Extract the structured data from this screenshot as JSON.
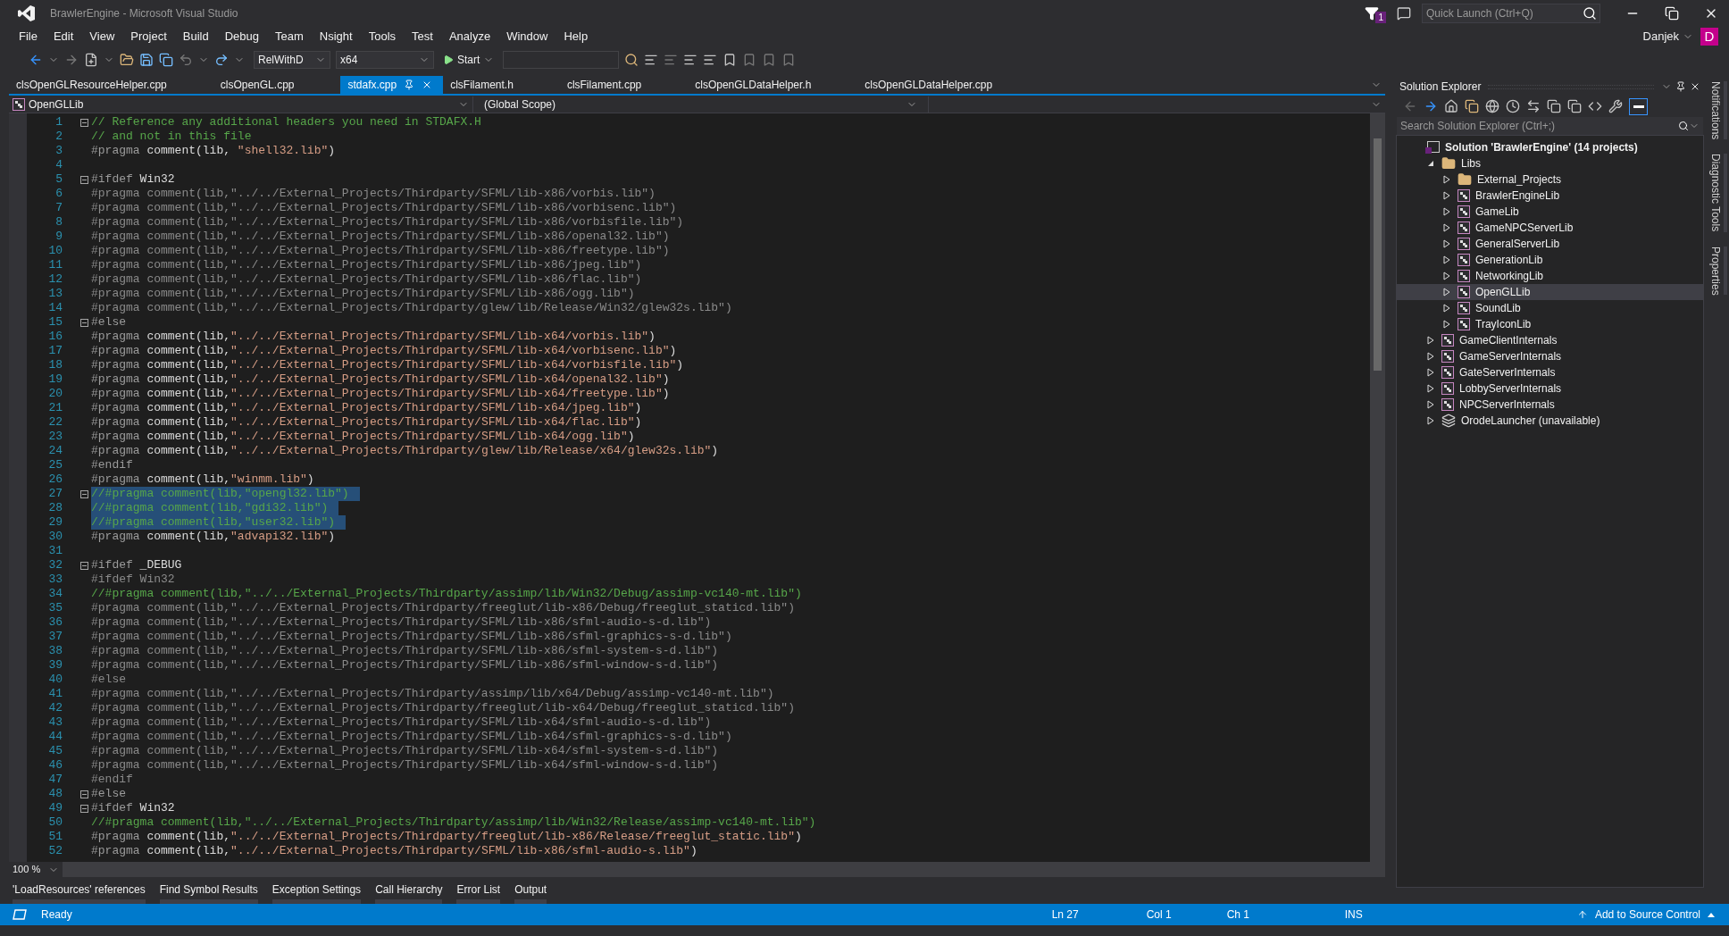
{
  "window": {
    "title": "BrawlerEngine - Microsoft Visual Studio",
    "notification_count": "1",
    "quick_launch": {
      "placeholder": "Quick Launch (Ctrl+Q)"
    },
    "user": "Danjek",
    "avatar_letter": "D"
  },
  "menu": [
    "File",
    "Edit",
    "View",
    "Project",
    "Build",
    "Debug",
    "Team",
    "Nsight",
    "Tools",
    "Test",
    "Analyze",
    "Window",
    "Help"
  ],
  "toolbar": {
    "configuration": "RelWithD",
    "platform": "x64",
    "start": "Start"
  },
  "tabs": [
    {
      "label": "clsOpenGLResourceHelper.cpp",
      "selected": false
    },
    {
      "label": "clsOpenGL.cpp",
      "selected": false
    },
    {
      "label": "stdafx.cpp",
      "selected": true
    },
    {
      "label": "clsFilament.h",
      "selected": false
    },
    {
      "label": "clsFilament.cpp",
      "selected": false
    },
    {
      "label": "clsOpenGLDataHelper.h",
      "selected": false
    },
    {
      "label": "clsOpenGLDataHelper.cpp",
      "selected": false
    }
  ],
  "navigation": {
    "project": "OpenGLLib",
    "scope": "(Global Scope)"
  },
  "code_lines": [
    {
      "n": "1",
      "text": "// Reference any additional headers you need in STDAFX.H",
      "kind": "comment",
      "fold": true,
      "selected": false
    },
    {
      "n": "2",
      "text": "// and not in this file",
      "kind": "comment",
      "fold": false,
      "selected": false
    },
    {
      "n": "3",
      "text": "#pragma comment(lib, \"shell32.lib\")",
      "kind": "active",
      "fold": false,
      "selected": false
    },
    {
      "n": "4",
      "kind": "blank"
    },
    {
      "n": "5",
      "text": "#ifdef Win32",
      "kind": "active",
      "fold": true,
      "selected": false
    },
    {
      "n": "6",
      "text": "#pragma comment(lib,\"../../External_Projects/Thirdparty/SFML/lib-x86/vorbis.lib\")",
      "kind": "inactive",
      "fold": false,
      "selected": false
    },
    {
      "n": "7",
      "text": "#pragma comment(lib,\"../../External_Projects/Thirdparty/SFML/lib-x86/vorbisenc.lib\")",
      "kind": "inactive",
      "fold": false,
      "selected": false
    },
    {
      "n": "8",
      "text": "#pragma comment(lib,\"../../External_Projects/Thirdparty/SFML/lib-x86/vorbisfile.lib\")",
      "kind": "inactive",
      "fold": false,
      "selected": false
    },
    {
      "n": "9",
      "text": "#pragma comment(lib,\"../../External_Projects/Thirdparty/SFML/lib-x86/openal32.lib\")",
      "kind": "inactive",
      "fold": false,
      "selected": false
    },
    {
      "n": "10",
      "text": "#pragma comment(lib,\"../../External_Projects/Thirdparty/SFML/lib-x86/freetype.lib\")",
      "kind": "inactive",
      "fold": false,
      "selected": false
    },
    {
      "n": "11",
      "text": "#pragma comment(lib,\"../../External_Projects/Thirdparty/SFML/lib-x86/jpeg.lib\")",
      "kind": "inactive",
      "fold": false,
      "selected": false
    },
    {
      "n": "12",
      "text": "#pragma comment(lib,\"../../External_Projects/Thirdparty/SFML/lib-x86/flac.lib\")",
      "kind": "inactive",
      "fold": false,
      "selected": false
    },
    {
      "n": "13",
      "text": "#pragma comment(lib,\"../../External_Projects/Thirdparty/SFML/lib-x86/ogg.lib\")",
      "kind": "inactive",
      "fold": false,
      "selected": false
    },
    {
      "n": "14",
      "text": "#pragma comment(lib,\"../../External_Projects/Thirdparty/glew/lib/Release/Win32/glew32s.lib\")",
      "kind": "inactive",
      "fold": false,
      "selected": false
    },
    {
      "n": "15",
      "text": "#else",
      "kind": "active",
      "fold": true,
      "selected": false
    },
    {
      "n": "16",
      "text": "#pragma comment(lib,\"../../External_Projects/Thirdparty/SFML/lib-x64/vorbis.lib\")",
      "kind": "active",
      "fold": false,
      "selected": false
    },
    {
      "n": "17",
      "text": "#pragma comment(lib,\"../../External_Projects/Thirdparty/SFML/lib-x64/vorbisenc.lib\")",
      "kind": "active",
      "fold": false,
      "selected": false
    },
    {
      "n": "18",
      "text": "#pragma comment(lib,\"../../External_Projects/Thirdparty/SFML/lib-x64/vorbisfile.lib\")",
      "kind": "active",
      "fold": false,
      "selected": false
    },
    {
      "n": "19",
      "text": "#pragma comment(lib,\"../../External_Projects/Thirdparty/SFML/lib-x64/openal32.lib\")",
      "kind": "active",
      "fold": false,
      "selected": false
    },
    {
      "n": "20",
      "text": "#pragma comment(lib,\"../../External_Projects/Thirdparty/SFML/lib-x64/freetype.lib\")",
      "kind": "active",
      "fold": false,
      "selected": false
    },
    {
      "n": "21",
      "text": "#pragma comment(lib,\"../../External_Projects/Thirdparty/SFML/lib-x64/jpeg.lib\")",
      "kind": "active",
      "fold": false,
      "selected": false
    },
    {
      "n": "22",
      "text": "#pragma comment(lib,\"../../External_Projects/Thirdparty/SFML/lib-x64/flac.lib\")",
      "kind": "active",
      "fold": false,
      "selected": false
    },
    {
      "n": "23",
      "text": "#pragma comment(lib,\"../../External_Projects/Thirdparty/SFML/lib-x64/ogg.lib\")",
      "kind": "active",
      "fold": false,
      "selected": false
    },
    {
      "n": "24",
      "text": "#pragma comment(lib,\"../../External_Projects/Thirdparty/glew/lib/Release/x64/glew32s.lib\")",
      "kind": "active",
      "fold": false,
      "selected": false
    },
    {
      "n": "25",
      "text": "#endif",
      "kind": "active",
      "fold": false,
      "selected": false
    },
    {
      "n": "26",
      "text": "#pragma comment(lib,\"winmm.lib\")",
      "kind": "active",
      "fold": false,
      "selected": false
    },
    {
      "n": "27",
      "text": "//#pragma comment(lib,\"opengl32.lib\")",
      "kind": "comment",
      "fold": true,
      "selected": true
    },
    {
      "n": "28",
      "text": "//#pragma comment(lib,\"gdi32.lib\")",
      "kind": "comment",
      "fold": false,
      "selected": true
    },
    {
      "n": "29",
      "text": "//#pragma comment(lib,\"user32.lib\")",
      "kind": "comment",
      "fold": false,
      "selected": true
    },
    {
      "n": "30",
      "text": "#pragma comment(lib,\"advapi32.lib\")",
      "kind": "active",
      "fold": false,
      "selected": false
    },
    {
      "n": "31",
      "kind": "blank"
    },
    {
      "n": "32",
      "text": "#ifdef _DEBUG",
      "kind": "active",
      "fold": true,
      "selected": false
    },
    {
      "n": "33",
      "text": "#ifdef Win32",
      "kind": "inactive",
      "fold": false,
      "selected": false
    },
    {
      "n": "34",
      "text": "//#pragma comment(lib,\"../../External_Projects/Thirdparty/assimp/lib/Win32/Debug/assimp-vc140-mt.lib\")",
      "kind": "comment",
      "fold": false,
      "selected": false
    },
    {
      "n": "35",
      "text": "#pragma comment(lib,\"../../External_Projects/Thirdparty/freeglut/lib-x86/Debug/freeglut_staticd.lib\")",
      "kind": "inactive",
      "fold": false,
      "selected": false
    },
    {
      "n": "36",
      "text": "#pragma comment(lib,\"../../External_Projects/Thirdparty/SFML/lib-x86/sfml-audio-s-d.lib\")",
      "kind": "inactive",
      "fold": false,
      "selected": false
    },
    {
      "n": "37",
      "text": "#pragma comment(lib,\"../../External_Projects/Thirdparty/SFML/lib-x86/sfml-graphics-s-d.lib\")",
      "kind": "inactive",
      "fold": false,
      "selected": false
    },
    {
      "n": "38",
      "text": "#pragma comment(lib,\"../../External_Projects/Thirdparty/SFML/lib-x86/sfml-system-s-d.lib\")",
      "kind": "inactive",
      "fold": false,
      "selected": false
    },
    {
      "n": "39",
      "text": "#pragma comment(lib,\"../../External_Projects/Thirdparty/SFML/lib-x86/sfml-window-s-d.lib\")",
      "kind": "inactive",
      "fold": false,
      "selected": false
    },
    {
      "n": "40",
      "text": "#else",
      "kind": "inactive",
      "fold": false,
      "selected": false
    },
    {
      "n": "41",
      "text": "#pragma comment(lib,\"../../External_Projects/Thirdparty/assimp/lib/x64/Debug/assimp-vc140-mt.lib\")",
      "kind": "inactive",
      "fold": false,
      "selected": false
    },
    {
      "n": "42",
      "text": "#pragma comment(lib,\"../../External_Projects/Thirdparty/freeglut/lib-x64/Debug/freeglut_staticd.lib\")",
      "kind": "inactive",
      "fold": false,
      "selected": false
    },
    {
      "n": "43",
      "text": "#pragma comment(lib,\"../../External_Projects/Thirdparty/SFML/lib-x64/sfml-audio-s-d.lib\")",
      "kind": "inactive",
      "fold": false,
      "selected": false
    },
    {
      "n": "44",
      "text": "#pragma comment(lib,\"../../External_Projects/Thirdparty/SFML/lib-x64/sfml-graphics-s-d.lib\")",
      "kind": "inactive",
      "fold": false,
      "selected": false
    },
    {
      "n": "45",
      "text": "#pragma comment(lib,\"../../External_Projects/Thirdparty/SFML/lib-x64/sfml-system-s-d.lib\")",
      "kind": "inactive",
      "fold": false,
      "selected": false
    },
    {
      "n": "46",
      "text": "#pragma comment(lib,\"../../External_Projects/Thirdparty/SFML/lib-x64/sfml-window-s-d.lib\")",
      "kind": "inactive",
      "fold": false,
      "selected": false
    },
    {
      "n": "47",
      "text": "#endif",
      "kind": "inactive",
      "fold": false,
      "selected": false
    },
    {
      "n": "48",
      "text": "#else",
      "kind": "active",
      "fold": true,
      "selected": false
    },
    {
      "n": "49",
      "text": "#ifdef Win32",
      "kind": "active",
      "fold": true,
      "selected": false
    },
    {
      "n": "50",
      "text": "//#pragma comment(lib,\"../../External_Projects/Thirdparty/assimp/lib/Win32/Release/assimp-vc140-mt.lib\")",
      "kind": "comment",
      "fold": false,
      "selected": false
    },
    {
      "n": "51",
      "text": "#pragma comment(lib,\"../../External_Projects/Thirdparty/freeglut/lib-x86/Release/freeglut_static.lib\")",
      "kind": "active",
      "fold": false,
      "selected": false
    },
    {
      "n": "52",
      "text": "#pragma comment(lib,\"../../External_Projects/Thirdparty/SFML/lib-x86/sfml-audio-s.lib\")",
      "kind": "active",
      "fold": false,
      "selected": false
    }
  ],
  "zoom": "100 %",
  "bottom_tabs": [
    "'LoadResources' references",
    "Find Symbol Results",
    "Exception Settings",
    "Call Hierarchy",
    "Error List",
    "Output"
  ],
  "solution_explorer": {
    "title": "Solution Explorer",
    "search": {
      "placeholder": "Search Solution Explorer (Ctrl+;)"
    },
    "tree": [
      {
        "label": "Solution 'BrawlerEngine' (14 projects)",
        "kind": "solution",
        "selected": false,
        "children": [
          {
            "label": "Libs",
            "kind": "folder",
            "expanded": true,
            "selected": false,
            "children": [
              {
                "label": "External_Projects",
                "kind": "folder",
                "expanded": false,
                "selected": false
              },
              {
                "label": "BrawlerEngineLib",
                "kind": "project",
                "expanded": false,
                "selected": false
              },
              {
                "label": "GameLib",
                "kind": "project",
                "expanded": false,
                "selected": false
              },
              {
                "label": "GameNPCServerLib",
                "kind": "project",
                "expanded": false,
                "selected": false
              },
              {
                "label": "GeneralServerLib",
                "kind": "project",
                "expanded": false,
                "selected": false
              },
              {
                "label": "GenerationLib",
                "kind": "project",
                "expanded": false,
                "selected": false
              },
              {
                "label": "NetworkingLib",
                "kind": "project",
                "expanded": false,
                "selected": false
              },
              {
                "label": "OpenGLLib",
                "kind": "project",
                "expanded": false,
                "selected": true
              },
              {
                "label": "SoundLib",
                "kind": "project",
                "expanded": false,
                "selected": false
              },
              {
                "label": "TrayIconLib",
                "kind": "project",
                "expanded": false,
                "selected": false
              }
            ]
          },
          {
            "label": "GameClientInternals",
            "kind": "project",
            "expanded": false,
            "selected": false
          },
          {
            "label": "GameServerInternals",
            "kind": "project",
            "expanded": false,
            "selected": false
          },
          {
            "label": "GateServerInternals",
            "kind": "project",
            "expanded": false,
            "selected": false
          },
          {
            "label": "LobbyServerInternals",
            "kind": "project",
            "expanded": false,
            "selected": false
          },
          {
            "label": "NPCServerInternals",
            "kind": "project",
            "expanded": false,
            "selected": false
          },
          {
            "label": "OrodeLauncher (unavailable)",
            "kind": "unavailable",
            "expanded": false,
            "selected": false
          }
        ]
      }
    ]
  },
  "side_tabs": [
    "Notifications",
    "Diagnostic Tools",
    "Properties"
  ],
  "status_bar": {
    "state": "Ready",
    "line": "Ln 27",
    "column": "Col 1",
    "char": "Ch 1",
    "mode": "INS",
    "source_control": "Add to Source Control"
  }
}
